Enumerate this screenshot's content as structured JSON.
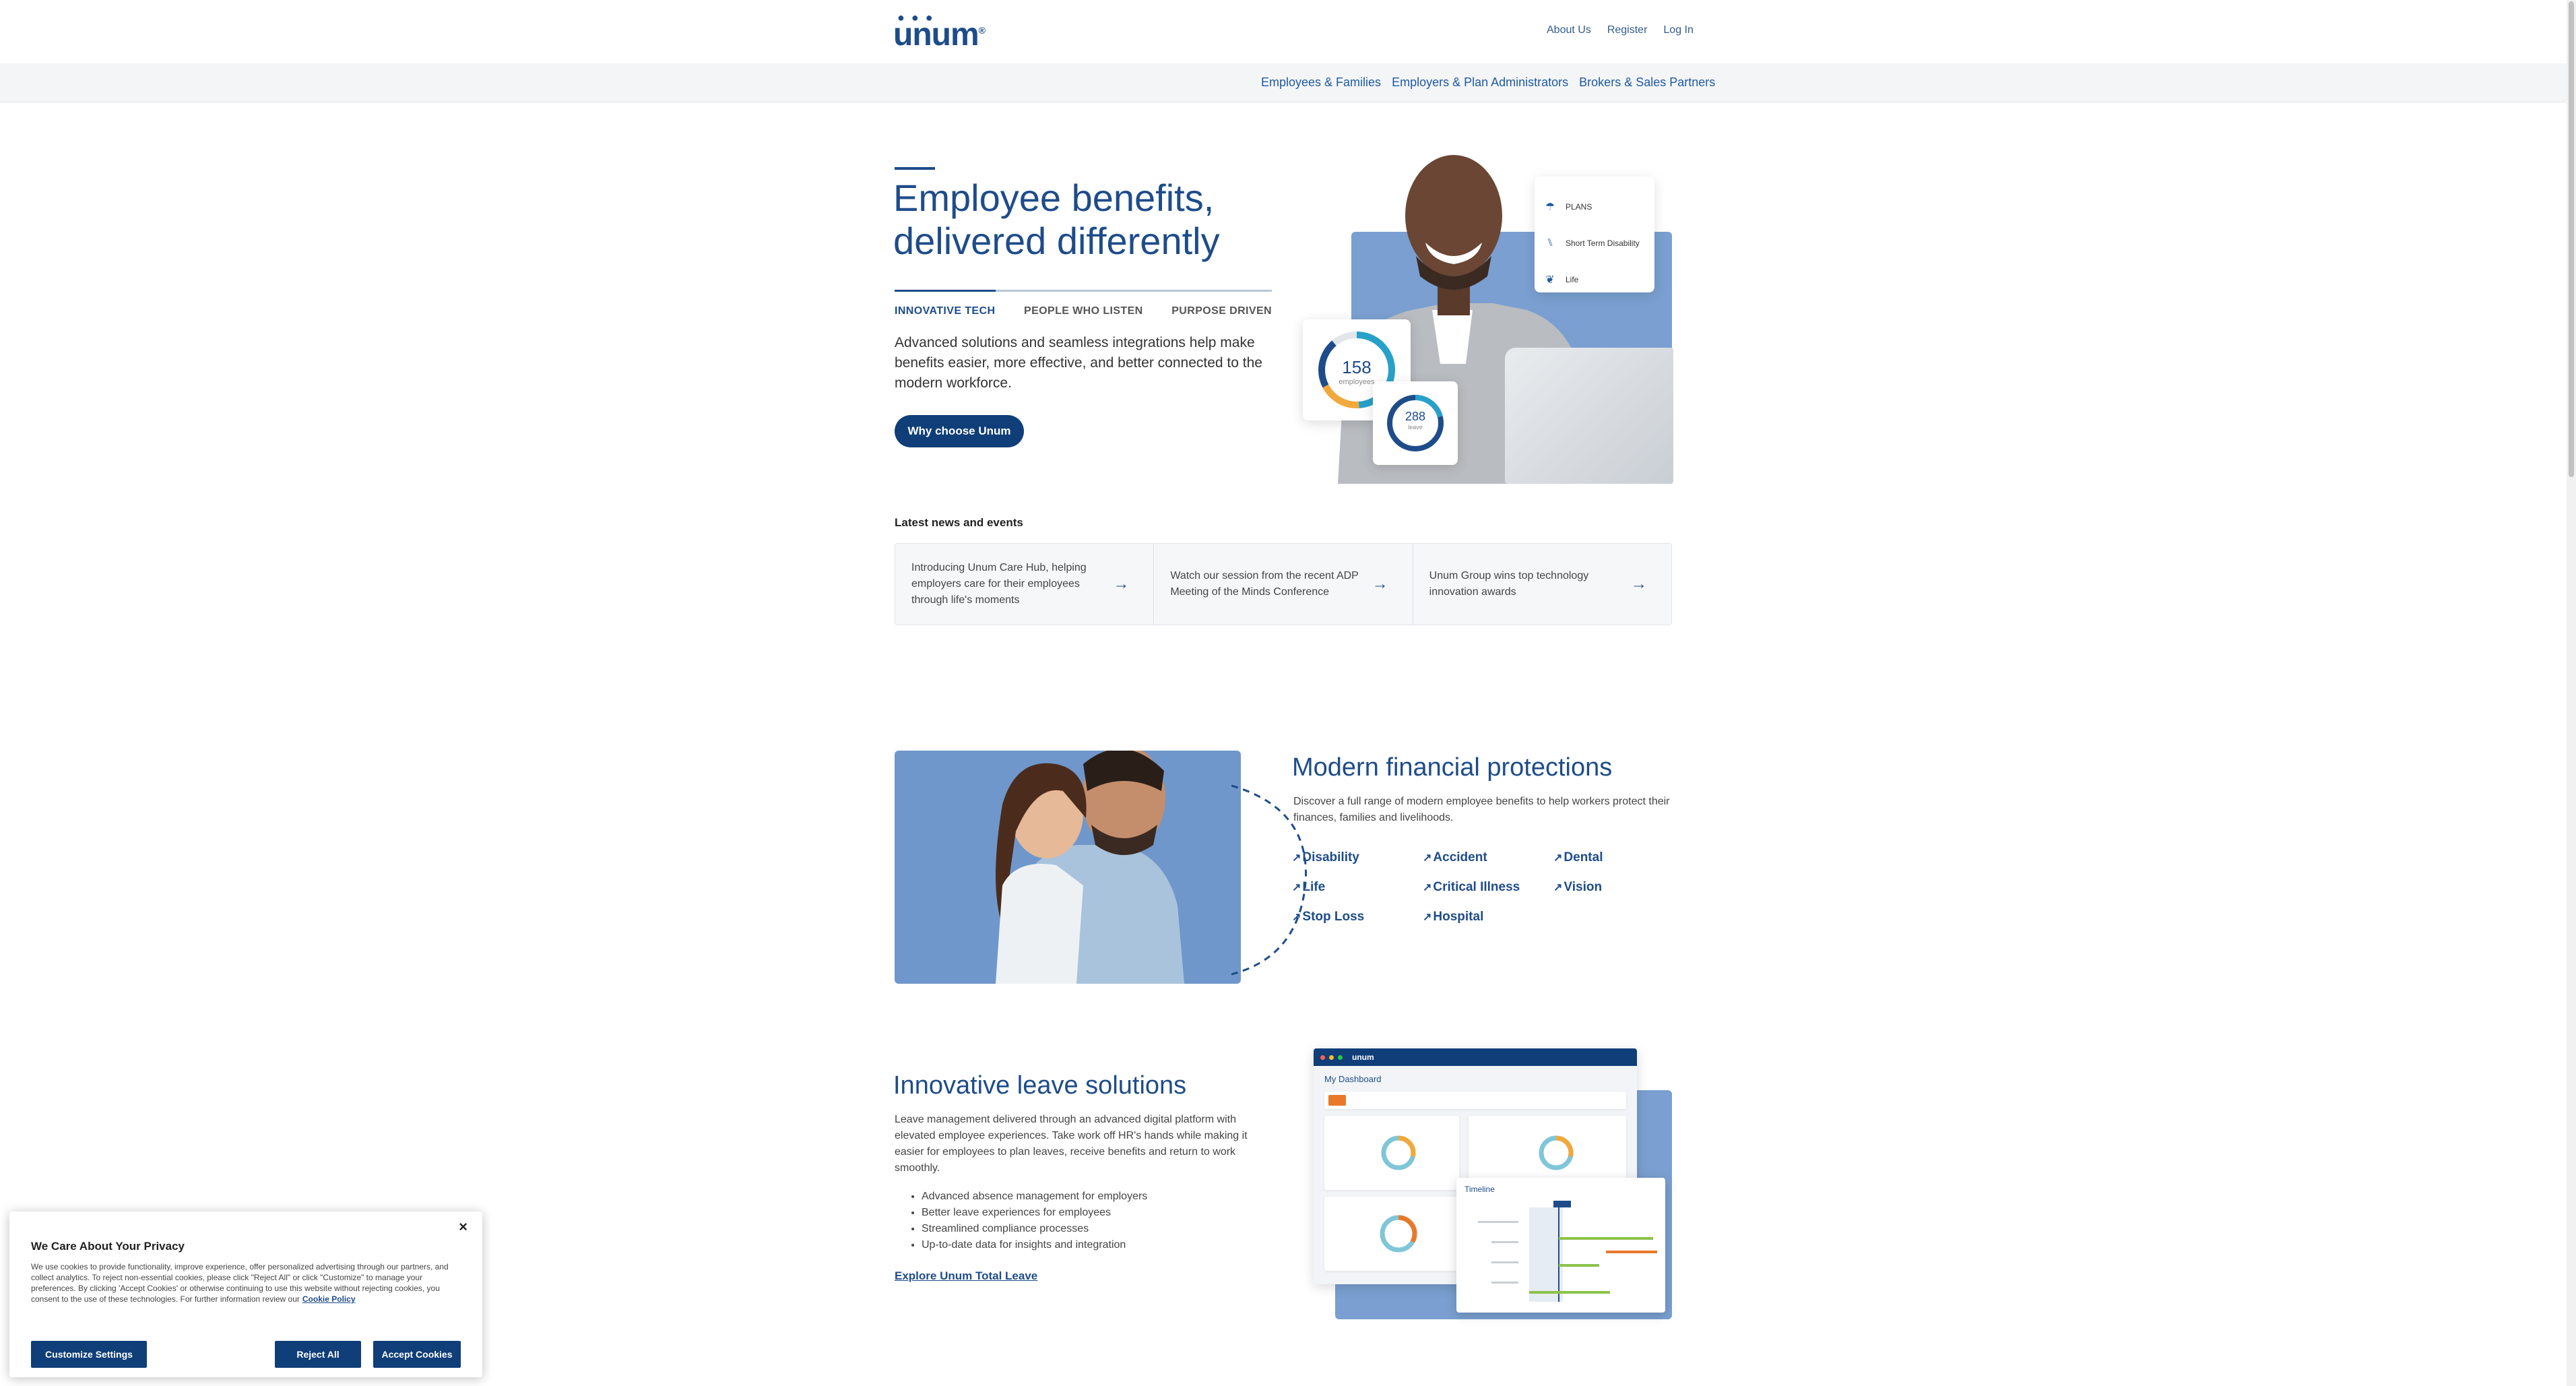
{
  "header": {
    "logo_text": "unum",
    "utility_nav": [
      "About Us",
      "Register",
      "Log In"
    ],
    "audience_nav": [
      "Employees & Families",
      "Employers & Plan Administrators",
      "Brokers & Sales Partners"
    ]
  },
  "hero": {
    "title_line1": "Employee benefits,",
    "title_line2": "delivered differently",
    "tabs": [
      "INNOVATIVE TECH",
      "PEOPLE WHO LISTEN",
      "PURPOSE DRIVEN"
    ],
    "active_tab": "INNOVATIVE TECH",
    "description": "Advanced solutions and seamless integrations help make benefits easier, more effective, and better connected to the modern workforce.",
    "cta_label": "Why choose Unum",
    "plans_card": [
      "PLANS",
      "Short Term Disability",
      "Life"
    ],
    "donut_big": {
      "value": "158",
      "label": "employees"
    },
    "donut_small": {
      "value": "288",
      "label": "leave"
    }
  },
  "news": {
    "heading": "Latest news and events",
    "items": [
      "Introducing Unum Care Hub, helping employers care for their employees through life's moments",
      "Watch our session from the recent ADP Meeting of the Minds Conference",
      "Unum Group wins top technology innovation awards"
    ]
  },
  "protections": {
    "title": "Modern financial protections",
    "description": "Discover a full range of modern employee benefits to help workers protect their finances, families and livelihoods.",
    "links": [
      "Disability",
      "Accident",
      "Dental",
      "Life",
      "Critical Illness",
      "Vision",
      "Stop Loss",
      "Hospital"
    ]
  },
  "leave": {
    "title": "Innovative leave solutions",
    "description": "Leave management delivered through an advanced digital platform with elevated employee experiences. Take work off HR's hands while making it easier for employees to plan leaves, receive benefits and return to work smoothly.",
    "bullets": [
      "Advanced absence management for employers",
      "Better leave experiences for employees",
      "Streamlined compliance processes",
      "Up-to-date data for insights and integration"
    ],
    "link_label": "Explore Unum Total Leave",
    "dashboard": {
      "brand": "unum",
      "heading": "My Dashboard",
      "timeline_title": "Timeline"
    }
  },
  "cookie": {
    "title": "We Care About Your Privacy",
    "text": "We use cookies to provide functionality, improve experience, offer personalized advertising through our partners, and collect analytics. To reject non-essential cookies, please click \"Reject All\" or click \"Customize\" to manage your preferences. By clicking 'Accept Cookies' or otherwise continuing to use this website without rejecting cookies, you consent to the use of these technologies. For further information review our",
    "policy_link": "Cookie Policy",
    "buttons": {
      "customize": "Customize Settings",
      "reject": "Reject All",
      "accept": "Accept Cookies"
    },
    "close_symbol": "×"
  },
  "colors": {
    "brand_blue": "#1e4c8a",
    "button_navy": "#0f3e78",
    "hero_blue": "#7a9fd0"
  },
  "icons": [
    "umbrella-icon",
    "crutches-icon",
    "leaf-icon",
    "arrow-right-icon",
    "external-arrow-icon",
    "close-icon"
  ]
}
